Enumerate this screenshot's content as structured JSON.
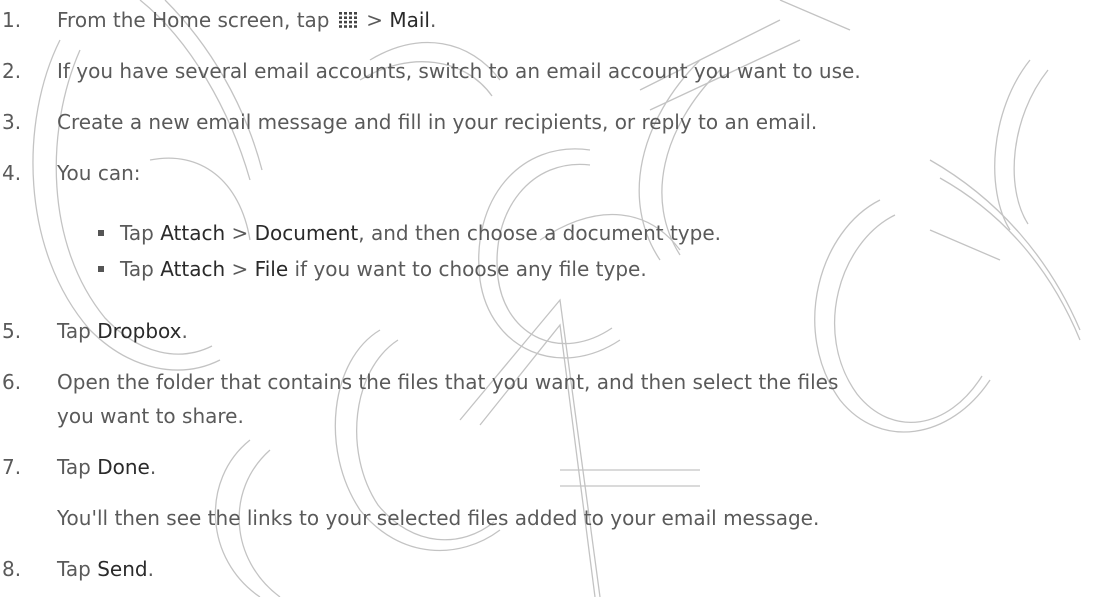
{
  "steps": {
    "s1": {
      "num": "1.",
      "pre": "From the Home screen, tap",
      "icon": "apps-grid-icon",
      "sep": " > ",
      "bold": "Mail",
      "post": "."
    },
    "s2": {
      "num": "2.",
      "text": "If you have several email accounts, switch to an email account you want to use."
    },
    "s3": {
      "num": "3.",
      "text": "Create a new email message and fill in your recipients, or reply to an email."
    },
    "s4": {
      "num": "4.",
      "text": "You can:"
    },
    "s5": {
      "num": "5.",
      "pre": "Tap ",
      "bold": "Dropbox",
      "post": "."
    },
    "s6": {
      "num": "6.",
      "line1": "Open the folder that contains the files that you want, and then select the files",
      "line2": "you want to share."
    },
    "s7": {
      "num": "7.",
      "pre": "Tap ",
      "bold": "Done",
      "post": ".",
      "note": "You'll then see the links to your selected files added to your email message."
    },
    "s8": {
      "num": "8.",
      "pre": "Tap ",
      "bold": "Send",
      "post": "."
    }
  },
  "subitems": {
    "a": {
      "pre": "Tap ",
      "bold1": "Attach",
      "sep": " > ",
      "bold2": "Document",
      "post": ", and then choose a document type."
    },
    "b": {
      "pre": "Tap ",
      "bold1": "Attach",
      "sep": " > ",
      "bold2": "File",
      "post": " if you want to choose any file type."
    }
  },
  "watermark": {
    "text": "HTC Confidential FCC Certification NOT",
    "color": "#9a9a9a"
  }
}
